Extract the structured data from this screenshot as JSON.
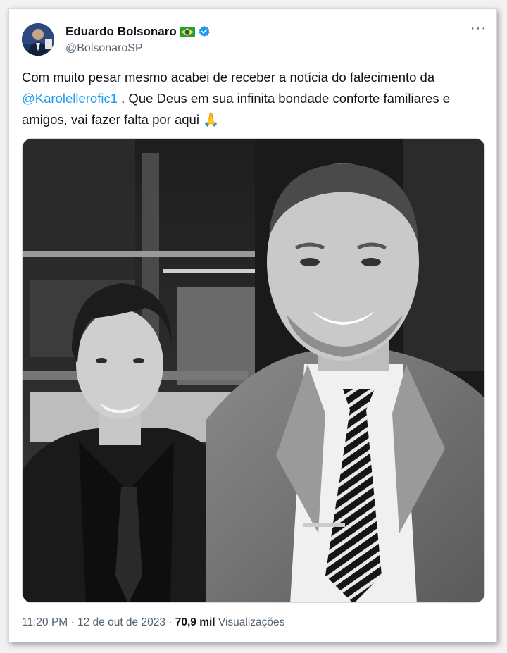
{
  "user": {
    "display_name": "Eduardo Bolsonaro",
    "handle": "@BolsonaroSP",
    "flag_icon": "brazil-flag-icon",
    "verified_icon": "verified-badge-icon"
  },
  "more_icon": "more-options-icon",
  "tweet": {
    "text_before": "Com muito pesar mesmo acabei de receber a notícia do falecimento da ",
    "mention": "@Karolellerofic1",
    "text_after": " . Que Deus em sua infinita bondade conforte familiares e amigos, vai fazer falta por aqui ",
    "emoji": "🙏"
  },
  "meta": {
    "time": "11:20 PM",
    "sep1": " · ",
    "date": "12 de out de 2023",
    "sep2": " · ",
    "views_count": "70,9 mil",
    "views_label": " Visualizações"
  },
  "colors": {
    "accent": "#1d9bf0",
    "text": "#0f1419",
    "secondary": "#536471"
  }
}
